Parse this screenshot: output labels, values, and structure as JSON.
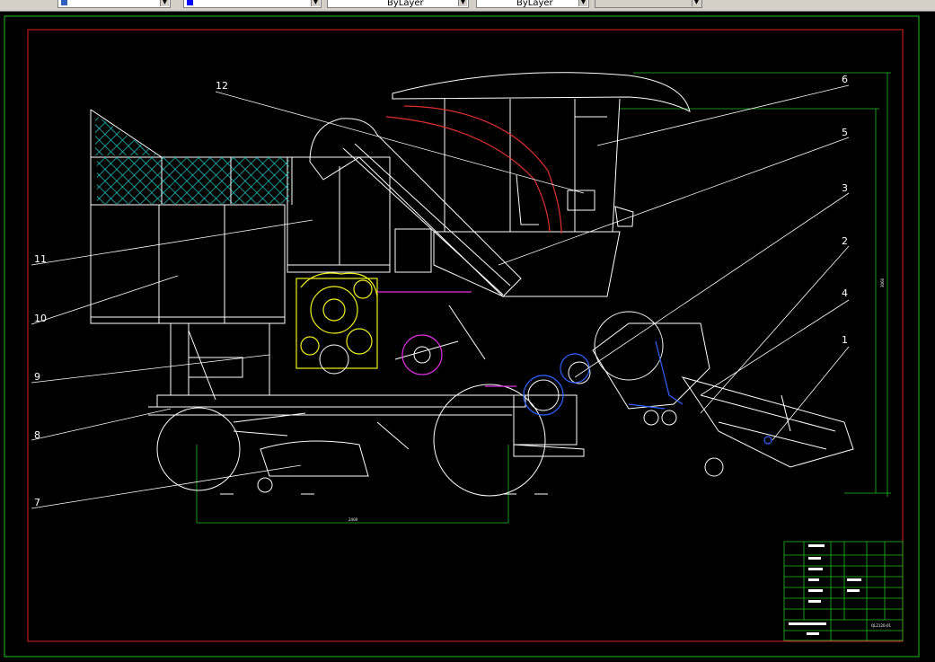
{
  "toolbar": {
    "layer_field": "",
    "color_field": "",
    "linetype_field": "ByLayer",
    "lineweight_field": "ByLayer",
    "plotstyle_field": ""
  },
  "drawing": {
    "callouts": [
      "1",
      "2",
      "3",
      "4",
      "5",
      "6",
      "7",
      "8",
      "9",
      "10",
      "11",
      "12"
    ],
    "dim_overall_height": "3060",
    "dim_wheelbase": "2400"
  },
  "title_block": {
    "drawing_no": "QL2120-01"
  },
  "colors": {
    "background": "#000000",
    "frame_red": "#e02020",
    "frame_green": "#20c020",
    "lines": "#ffffff",
    "engine": "#f0f020",
    "pipe": "#e03030",
    "hydraulic": "#e030e0",
    "blue_parts": "#3060ff",
    "grid_cyan": "#20d0d0"
  }
}
